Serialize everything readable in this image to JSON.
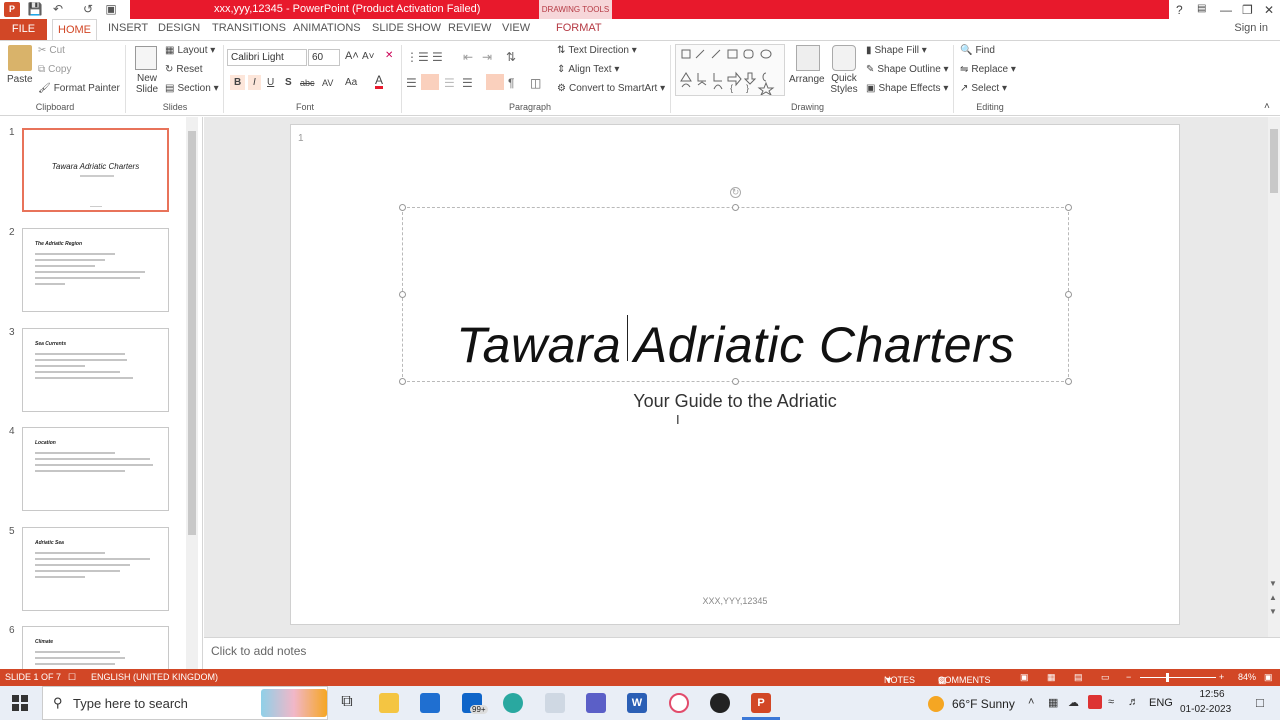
{
  "titlebar": {
    "window_title": "xxx,yyy,12345  -  PowerPoint (Product Activation Failed)",
    "context_tab_group": "DRAWING TOOLS",
    "help": "?",
    "minimize": "—",
    "restore": "❐",
    "close": "✕"
  },
  "tabs": {
    "file": "FILE",
    "home": "HOME",
    "insert": "INSERT",
    "design": "DESIGN",
    "transitions": "TRANSITIONS",
    "animations": "ANIMATIONS",
    "slideshow": "SLIDE SHOW",
    "review": "REVIEW",
    "view": "VIEW",
    "format": "FORMAT",
    "signin": "Sign in"
  },
  "ribbon": {
    "clipboard": {
      "label": "Clipboard",
      "paste": "Paste",
      "cut": "Cut",
      "copy": "Copy",
      "format_painter": "Format Painter"
    },
    "slides": {
      "label": "Slides",
      "new_slide": "New Slide",
      "layout": "Layout",
      "reset": "Reset",
      "section": "Section"
    },
    "font": {
      "label": "Font",
      "family": "Calibri Light",
      "size": "60",
      "bold": "B",
      "italic": "I",
      "underline": "U",
      "shadow": "S",
      "strike": "abc",
      "spacing": "AV",
      "case": "Aa",
      "color": "A"
    },
    "paragraph": {
      "label": "Paragraph",
      "text_direction": "Text Direction",
      "align_text": "Align Text",
      "convert_smartart": "Convert to SmartArt"
    },
    "drawing": {
      "label": "Drawing",
      "arrange": "Arrange",
      "quick_styles": "Quick Styles",
      "shape_fill": "Shape Fill",
      "shape_outline": "Shape Outline",
      "shape_effects": "Shape Effects"
    },
    "editing": {
      "label": "Editing",
      "find": "Find",
      "replace": "Replace",
      "select": "Select"
    }
  },
  "thumbnails": [
    {
      "num": "1",
      "title": "Tawara Adriatic Charters",
      "selected": true
    },
    {
      "num": "2",
      "title": "The Adriatic Region"
    },
    {
      "num": "3",
      "title": "Sea Currents"
    },
    {
      "num": "4",
      "title": "Location"
    },
    {
      "num": "5",
      "title": "Adriatic Sea"
    },
    {
      "num": "6",
      "title": "Climate"
    }
  ],
  "slide": {
    "number": "1",
    "title": "Tawara Adriatic Charters",
    "subtitle": "Your Guide to the Adriatic",
    "footer": "XXX,YYY,12345"
  },
  "notes_placeholder": "Click to add notes",
  "statusbar": {
    "slide_of": "SLIDE 1 OF 7",
    "language": "ENGLISH (UNITED KINGDOM)",
    "notes": "NOTES",
    "comments": "COMMENTS",
    "zoom": "84%"
  },
  "taskbar": {
    "search_placeholder": "Type here to search",
    "mail_badge": "99+",
    "weather": "66°F  Sunny",
    "lang": "ENG",
    "time": "12:56",
    "date": "01-02-2023"
  }
}
